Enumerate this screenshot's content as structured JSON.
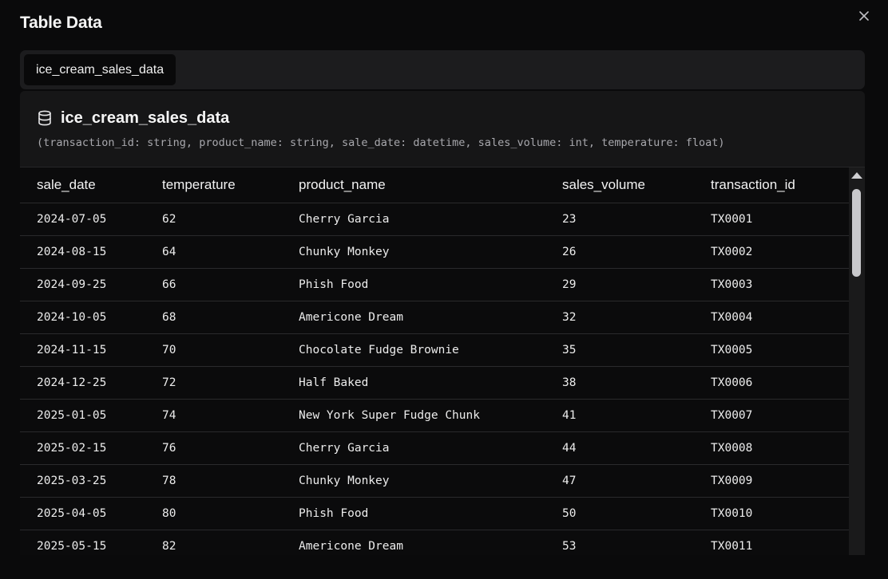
{
  "modal": {
    "title": "Table Data",
    "close_icon": "close-icon"
  },
  "tabs": [
    {
      "label": "ice_cream_sales_data",
      "active": true
    }
  ],
  "panel": {
    "icon": "database-icon",
    "title": "ice_cream_sales_data",
    "schema": "(transaction_id: string, product_name: string, sale_date: datetime, sales_volume: int, temperature: float)"
  },
  "table": {
    "columns": [
      "sale_date",
      "temperature",
      "product_name",
      "sales_volume",
      "transaction_id"
    ],
    "rows": [
      [
        "2024-07-05",
        "62",
        "Cherry Garcia",
        "23",
        "TX0001"
      ],
      [
        "2024-08-15",
        "64",
        "Chunky Monkey",
        "26",
        "TX0002"
      ],
      [
        "2024-09-25",
        "66",
        "Phish Food",
        "29",
        "TX0003"
      ],
      [
        "2024-10-05",
        "68",
        "Americone Dream",
        "32",
        "TX0004"
      ],
      [
        "2024-11-15",
        "70",
        "Chocolate Fudge Brownie",
        "35",
        "TX0005"
      ],
      [
        "2024-12-25",
        "72",
        "Half Baked",
        "38",
        "TX0006"
      ],
      [
        "2025-01-05",
        "74",
        "New York Super Fudge Chunk",
        "41",
        "TX0007"
      ],
      [
        "2025-02-15",
        "76",
        "Cherry Garcia",
        "44",
        "TX0008"
      ],
      [
        "2025-03-25",
        "78",
        "Chunky Monkey",
        "47",
        "TX0009"
      ],
      [
        "2025-04-05",
        "80",
        "Phish Food",
        "50",
        "TX0010"
      ],
      [
        "2025-05-15",
        "82",
        "Americone Dream",
        "53",
        "TX0011"
      ]
    ]
  },
  "colors": {
    "background": "#0a0a0b",
    "surface": "#1c1c1e",
    "text": "#ededed",
    "muted_text": "#a8a8ad"
  }
}
